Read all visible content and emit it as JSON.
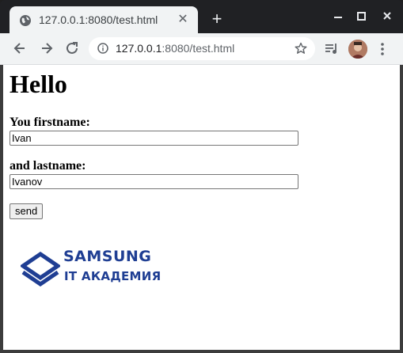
{
  "browser": {
    "tab": {
      "title": "127.0.0.1:8080/test.html",
      "favicon": "globe-icon",
      "close_glyph": "✕"
    },
    "new_tab_glyph": "+",
    "window_controls": [
      "minimize-icon",
      "maximize-icon",
      "close-icon"
    ],
    "address": {
      "host": "127.0.0.1",
      "rest": ":8080/test.html"
    }
  },
  "page": {
    "heading": "Hello",
    "firstname_label": "You firstname:",
    "firstname_value": "Ivan",
    "lastname_label": "and lastname:",
    "lastname_value": "Ivanov",
    "send_label": "send",
    "logo": {
      "line1": "SAMSUNG",
      "line2": "IT АКАДЕМИЯ",
      "color": "#1f3e93"
    }
  }
}
